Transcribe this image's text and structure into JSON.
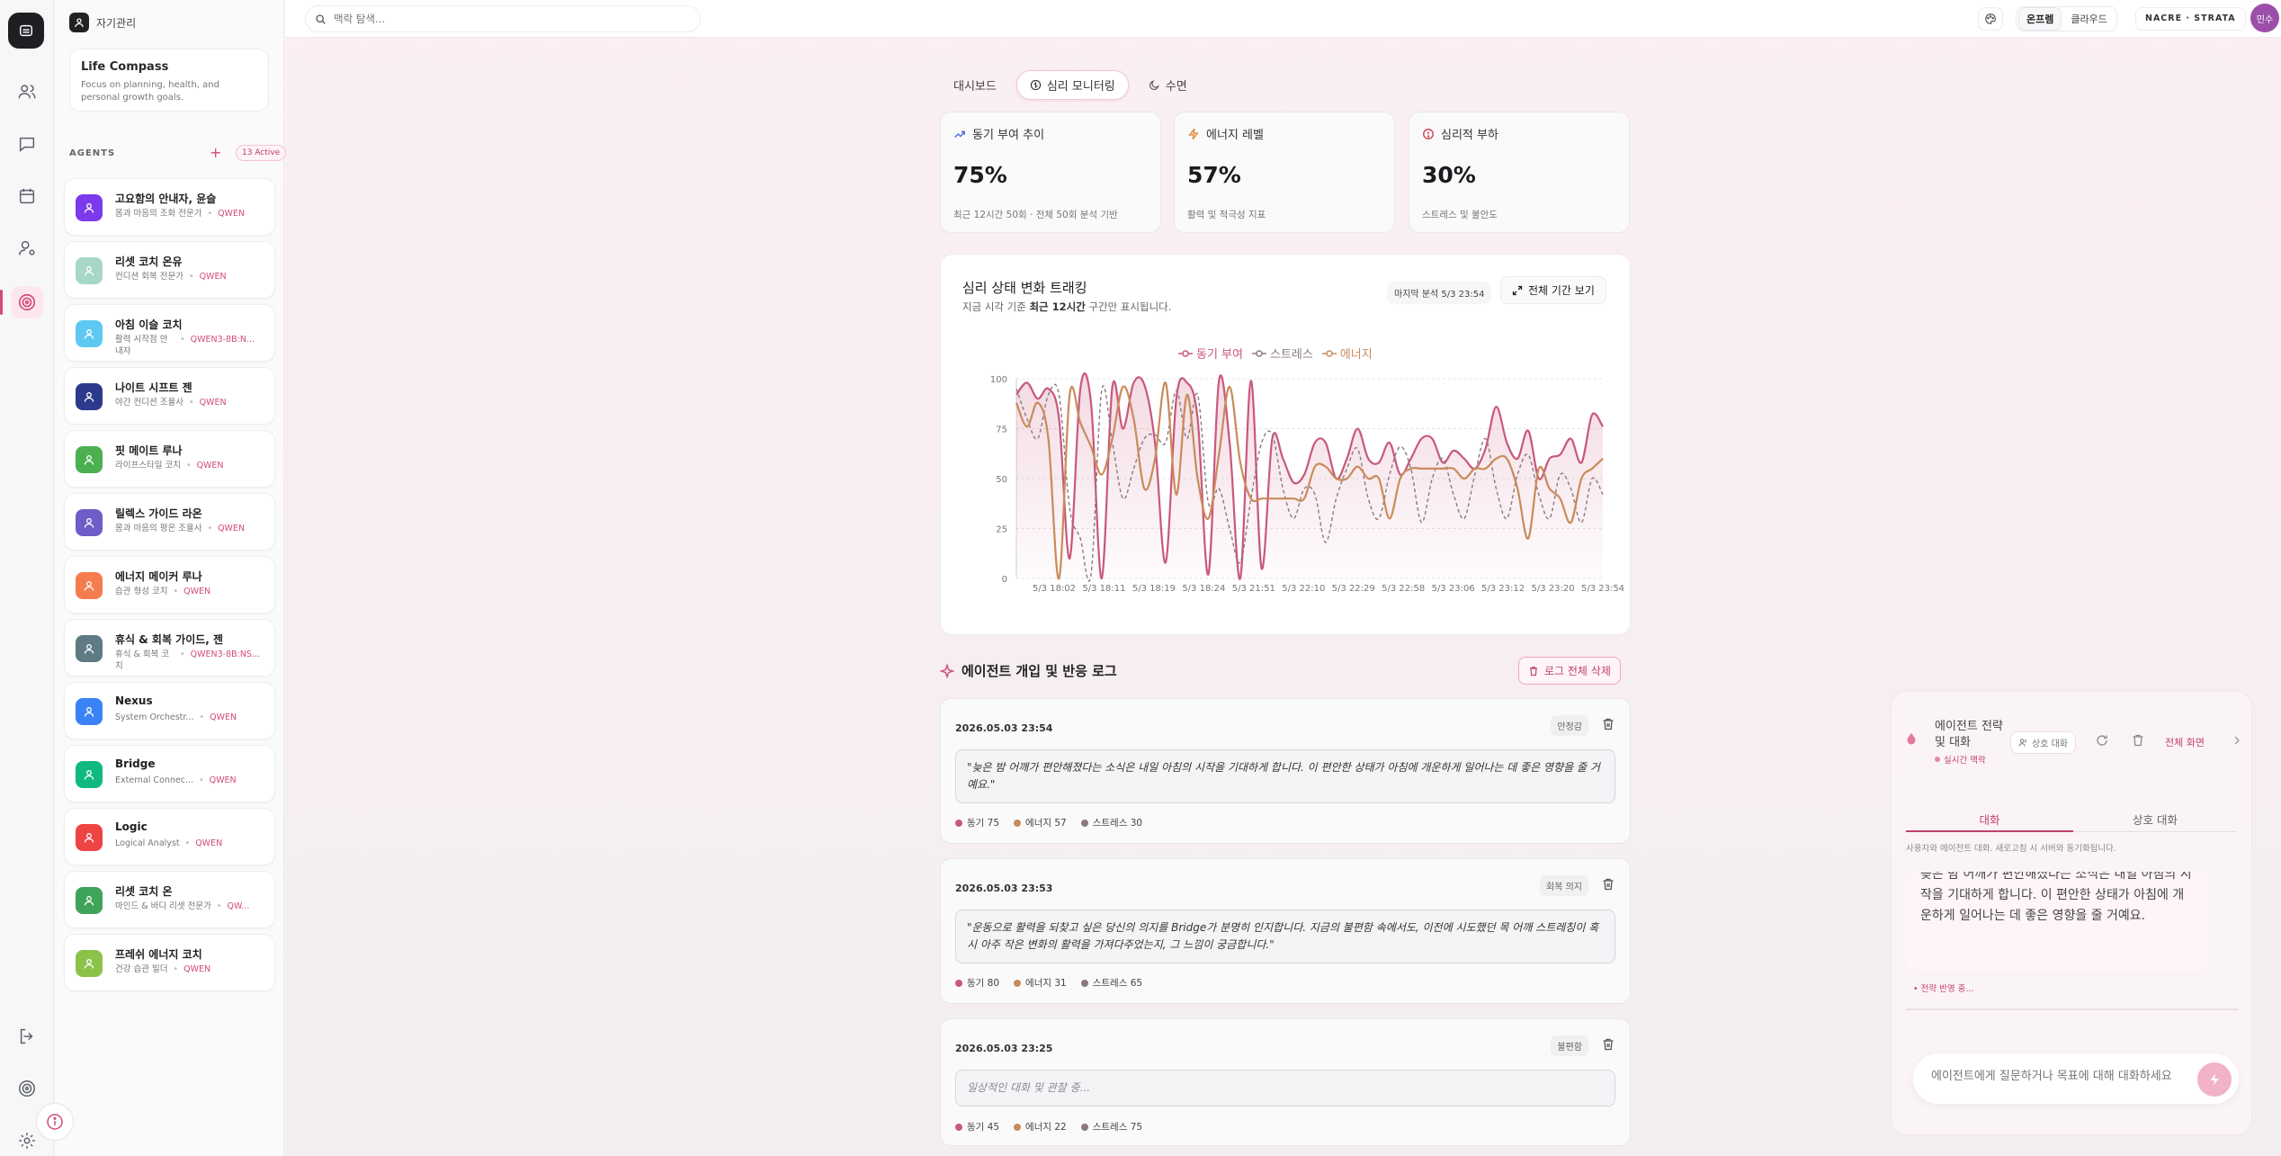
{
  "app": {
    "workspace_label": "자기관리",
    "search_placeholder": "맥락 탐색...",
    "mode_options": [
      "온프렘",
      "클라우드"
    ],
    "mode_selected": "온프렘",
    "workspace_badge": "NACRE · STRATA",
    "user_initials": "민수"
  },
  "compass": {
    "title": "Life Compass",
    "description": "Focus on planning, health, and personal growth goals."
  },
  "agents_section": {
    "label": "AGENTS",
    "active_badge": "13 Active"
  },
  "agents": [
    {
      "name": "고요함의 안내자, 윤슬",
      "role": "몸과 마음의 조화 전문가",
      "model": "QWEN",
      "color": "#7c3aed"
    },
    {
      "name": "리셋 코치 온유",
      "role": "컨디션 회복 전문가",
      "model": "QWEN",
      "color": "#a7d7c5"
    },
    {
      "name": "아침 이슬 코치",
      "role": "활력 시작점 안내자",
      "model": "QWEN3-8B:N...",
      "color": "#5ec8f2"
    },
    {
      "name": "나이트 시프트 젠",
      "role": "야간 컨디션 조율사",
      "model": "QWEN",
      "color": "#2d3a8c"
    },
    {
      "name": "핏 메이트 루나",
      "role": "라이프스타일 코치",
      "model": "QWEN",
      "color": "#4caf50"
    },
    {
      "name": "릴렉스 가이드 라온",
      "role": "몸과 마음의 평온 조율사",
      "model": "QWEN",
      "color": "#6f5cc7"
    },
    {
      "name": "에너지 메이커 루나",
      "role": "습관 형성 코치",
      "model": "QWEN",
      "color": "#f57c4e"
    },
    {
      "name": "휴식 & 회복 가이드, 젠",
      "role": "휴식 & 회복 코치",
      "model": "QWEN3-8B:NS...",
      "color": "#5f7a82"
    },
    {
      "name": "Nexus",
      "role": "System Orchestr...",
      "model": "QWEN",
      "color": "#3b82f6"
    },
    {
      "name": "Bridge",
      "role": "External Connec...",
      "model": "QWEN",
      "color": "#10b981"
    },
    {
      "name": "Logic",
      "role": "Logical Analyst",
      "model": "QWEN",
      "color": "#ef4444"
    },
    {
      "name": "리셋 코치 온",
      "role": "마인드 & 바디 리셋 전문가",
      "model": "QW...",
      "color": "#3fa35a"
    },
    {
      "name": "프레쉬 에너지 코치",
      "role": "건강 습관 빌더",
      "model": "QWEN",
      "color": "#8bc34a"
    }
  ],
  "tabs": [
    {
      "label": "대시보드",
      "icon": "none"
    },
    {
      "label": "심리 모니터링",
      "icon": "brain-icon"
    },
    {
      "label": "수면",
      "icon": "moon-icon"
    }
  ],
  "kpis": [
    {
      "title": "동기 부여 추이",
      "value": "75%",
      "desc": "최근 12시간 50회 · 전체 50회 분석 기반",
      "icon": "trend-up-icon",
      "color": "#4f6bd8"
    },
    {
      "title": "에너지 레벨",
      "value": "57%",
      "desc": "활력 및 적극성 지표",
      "icon": "bolt-icon",
      "color": "#e08a3a"
    },
    {
      "title": "심리적 부하",
      "value": "30%",
      "desc": "스트레스 및 불안도",
      "icon": "alert-circle-icon",
      "color": "#d0465a"
    }
  ],
  "chart_card": {
    "title": "심리 상태 변화 트래킹",
    "subtitle_prefix": "지금 시각 기준 ",
    "subtitle_bold": "최근 12시간",
    "subtitle_suffix": " 구간만 표시됩니다.",
    "last_analysis": "마지막 분석 5/3 23:54",
    "full_view_label": "전체 기간 보기"
  },
  "chart_data": {
    "type": "line",
    "ylim": [
      0,
      100
    ],
    "yticks": [
      0,
      25,
      50,
      75,
      100
    ],
    "x": [
      "5/3 18:02",
      "5/3 18:11",
      "5/3 18:19",
      "5/3 18:24",
      "5/3 21:51",
      "5/3 22:10",
      "5/3 22:29",
      "5/3 22:58",
      "5/3 23:06",
      "5/3 23:12",
      "5/3 23:20",
      "5/3 23:54"
    ],
    "grid": true,
    "legend_position": "top",
    "series": [
      {
        "name": "동기 부여",
        "color": "#c9587a",
        "style": "solid",
        "fill": true,
        "values": [
          92,
          98,
          90,
          95,
          80,
          10,
          95,
          88,
          0,
          96,
          75,
          98,
          97,
          68,
          8,
          90,
          98,
          80,
          2,
          99,
          68,
          0,
          99,
          5,
          70,
          60,
          48,
          52,
          68,
          68,
          50,
          60,
          75,
          60,
          58,
          68,
          52,
          60,
          70,
          70,
          58,
          64,
          60,
          55,
          65,
          86,
          68,
          60,
          74,
          50,
          60,
          62,
          70,
          58,
          82,
          76
        ]
      },
      {
        "name": "스트레스",
        "color": "#8a7a7c",
        "style": "dashed",
        "fill": false,
        "values": [
          95,
          80,
          70,
          92,
          92,
          35,
          20,
          2,
          94,
          68,
          40,
          55,
          70,
          72,
          68,
          94,
          70,
          92,
          38,
          45,
          25,
          8,
          40,
          68,
          72,
          45,
          30,
          45,
          42,
          18,
          40,
          55,
          65,
          40,
          30,
          52,
          66,
          55,
          28,
          50,
          60,
          42,
          30,
          52,
          70,
          45,
          30,
          52,
          62,
          42,
          30,
          52,
          45,
          28,
          50,
          42
        ]
      },
      {
        "name": "에너지",
        "color": "#c98b5a",
        "style": "solid",
        "fill": false,
        "values": [
          88,
          76,
          88,
          70,
          0,
          92,
          78,
          66,
          52,
          70,
          96,
          80,
          45,
          60,
          98,
          42,
          92,
          50,
          30,
          62,
          96,
          58,
          40,
          40,
          40,
          40,
          40,
          40,
          56,
          56,
          50,
          50,
          56,
          50,
          50,
          30,
          50,
          55,
          55,
          55,
          55,
          55,
          50,
          55,
          55,
          60,
          60,
          45,
          20,
          55,
          45,
          40,
          28,
          50,
          55,
          60
        ]
      }
    ]
  },
  "log_section": {
    "title": "에이전트 개입 및 반응 로그",
    "delete_all_label": "로그 전체 삭제"
  },
  "logs": [
    {
      "timestamp": "2026.05.03 23:54",
      "tag": "안정감",
      "text": "\"늦은 밤 어깨가 편안해졌다는 소식은 내일 아침의 시작을 기대하게 합니다. 이 편안한 상태가 아침에 개운하게 일어나는 데 좋은 영향을 줄 거예요.\"",
      "motivation": "동기 75",
      "energy": "에너지 57",
      "stress": "스트레스 30"
    },
    {
      "timestamp": "2026.05.03 23:53",
      "tag": "회복 의지",
      "text": "\"운동으로 활력을 되찾고 싶은 당신의 의지를 Bridge가 분명히 인지합니다. 지금의 불편함 속에서도, 이전에 시도했던 목 어깨 스트레칭이 혹시 아주 작은 변화의 활력을 가져다주었는지, 그 느낌이 궁금합니다.\"",
      "motivation": "동기 80",
      "energy": "에너지 31",
      "stress": "스트레스 65"
    },
    {
      "timestamp": "2026.05.03 23:25",
      "tag": "불편함",
      "text": "일상적인 대화 및 관찰 중...",
      "motivation": "동기 45",
      "energy": "에너지 22",
      "stress": "스트레스 75"
    }
  ],
  "chat": {
    "title": "에이전트 전략 및 대화",
    "status": "실시간 맥락",
    "mode_label": "상호 대화",
    "full_screen_label": "전체 화면",
    "tab_chat": "대화",
    "tab_mutual": "상호 대화",
    "note": "사용자와 에이전트 대화. 새로고침 시 서버와 동기화됩니다.",
    "message": "늦은 밤 어깨가 편안해졌다는 소식은 내일 아침의 시작을 기대하게 합니다. 이 편안한 상태가 아침에 개운하게 일어나는 데 좋은 영향을 줄 거예요.",
    "strategy_label": "전략 반영 중...",
    "input_placeholder": "에이전트에게 질문하거나 목표에 대해 대화하세요"
  },
  "colors": {
    "accent": "#d14b7a",
    "motivation": "#c9587a",
    "energy": "#c98b5a",
    "stress": "#8a7a7c"
  }
}
